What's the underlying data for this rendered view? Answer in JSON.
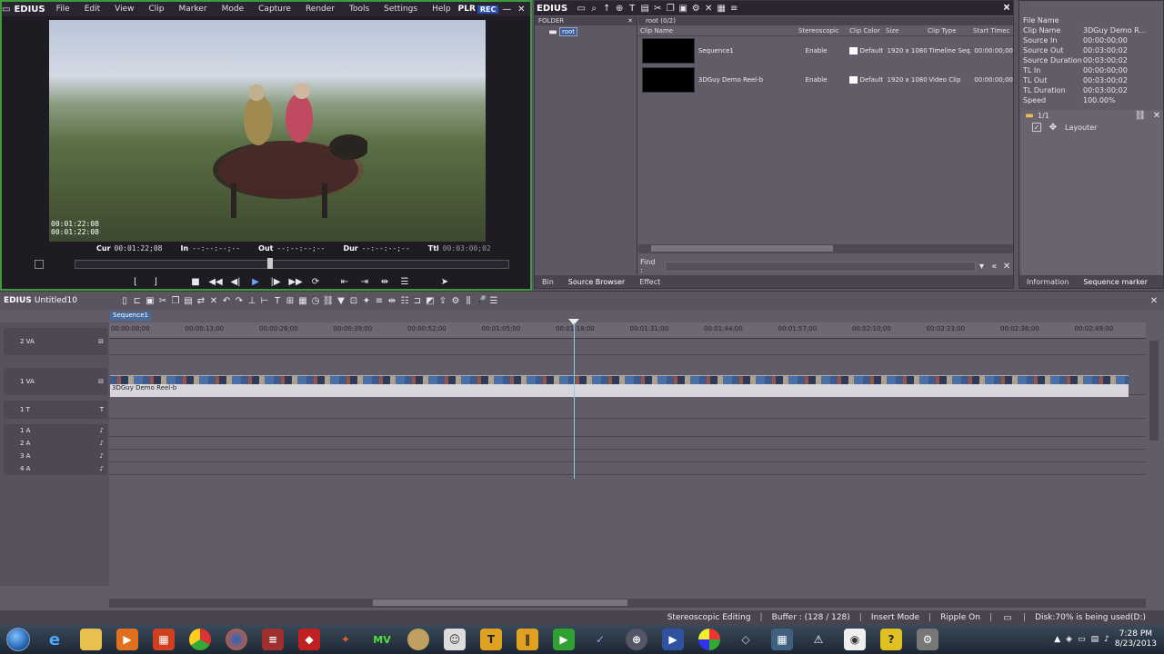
{
  "player": {
    "logo": "EDIUS",
    "menu": [
      "File",
      "Edit",
      "View",
      "Clip",
      "Marker",
      "Mode",
      "Capture",
      "Render",
      "Tools",
      "Settings",
      "Help"
    ],
    "plr": "PLR",
    "rec": "REC",
    "overlay_tc1": "00:01:22:08",
    "overlay_tc2": "00:01:22:08",
    "cur_label": "Cur",
    "cur_value": "00:01:22;08",
    "in_label": "In",
    "in_value": "--:--:--;--",
    "out_label": "Out",
    "out_value": "--:--:--;--",
    "dur_label": "Dur",
    "dur_value": "--:--:--;--",
    "ttl_label": "Ttl",
    "ttl_value": "00:03:00;02",
    "scrub_position": 0.45
  },
  "bin": {
    "logo": "EDIUS",
    "folder_label": "FOLDER",
    "root_label": "root",
    "clip_title": "root (0/2)",
    "headers": [
      "Clip Name",
      "Stereoscopic",
      "Clip Color",
      "Size",
      "Clip Type",
      "Start Timec"
    ],
    "clips": [
      {
        "name": "Sequence1",
        "stereo": "Enable",
        "color": "Default",
        "size": "1920 x 1080",
        "type": "Timeline Seq.",
        "start": "00:00:00;00"
      },
      {
        "name": "3DGuy Demo Reel-b",
        "stereo": "Enable",
        "color": "Default",
        "size": "1920 x 1080",
        "type": "Video Clip",
        "start": "00:00:00;00"
      }
    ],
    "find_label": "Find :",
    "tabs": [
      "Bin",
      "Source Browser",
      "Effect"
    ]
  },
  "info": {
    "rows": [
      {
        "key": "File Name",
        "val": ""
      },
      {
        "key": "Clip Name",
        "val": "3DGuy Demo R..."
      },
      {
        "key": "Source In",
        "val": "00:00:00;00"
      },
      {
        "key": "Source Out",
        "val": "00:03:00;02"
      },
      {
        "key": "Source Duration",
        "val": "00:03:00;02"
      },
      {
        "key": "TL In",
        "val": "00:00:00;00"
      },
      {
        "key": "TL Out",
        "val": "00:03:00;02"
      },
      {
        "key": "TL Duration",
        "val": "00:03:00;02"
      },
      {
        "key": "Speed",
        "val": "100.00%"
      }
    ],
    "layer_count": "1/1",
    "layouter": "Layouter",
    "tabs": [
      "Information",
      "Sequence marker"
    ]
  },
  "timeline": {
    "logo": "EDIUS",
    "project": "Untitled10",
    "sequence_tab": "Sequence1",
    "ticks": [
      "00:00:00;00",
      "00:00:13;00",
      "00:00:26;00",
      "00:00:39;00",
      "00:00:52;00",
      "00:01:05;00",
      "00:01:18;00",
      "00:01:31;00",
      "00:01:44;00",
      "00:01:57;00",
      "00:02:10;00",
      "00:02:23;00",
      "00:02:36;00",
      "00:02:49;00"
    ],
    "tracks": [
      "2 VA",
      "1 VA",
      "1 T",
      "1 A",
      "2 A",
      "3 A",
      "4 A"
    ],
    "clip_label": "3DGuy Demo Reel-b"
  },
  "status": {
    "items": [
      "Stereoscopic Editing",
      "Buffer : (128 / 128)",
      "Insert Mode",
      "Ripple On",
      "Disk:70% is being used(D:)"
    ]
  },
  "taskbar": {
    "time": "7:28 PM",
    "date": "8/23/2013"
  }
}
